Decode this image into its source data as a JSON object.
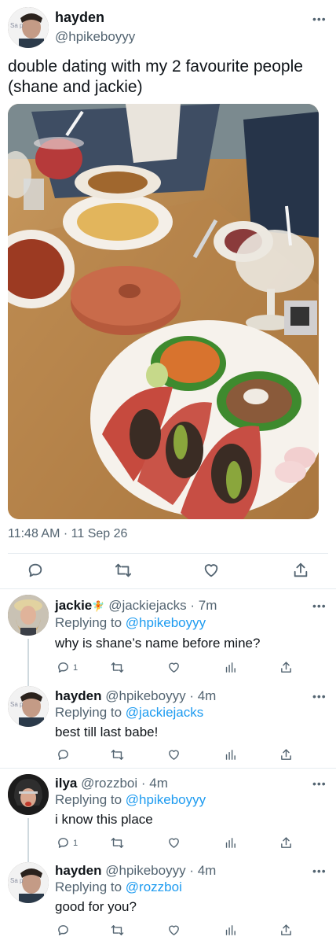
{
  "main_tweet": {
    "display_name": "hayden",
    "handle": "@hpikeboyyy",
    "text": "double dating with my 2 favourite people (shane and jackie)",
    "timestamp": "11:48 AM · 11 Sep 26",
    "avatar_text": "Sa p",
    "more": "•••"
  },
  "main_actions": [
    "reply-icon",
    "retweet-icon",
    "like-icon",
    "share-icon"
  ],
  "replies": [
    {
      "display_name": "jackie",
      "emoji": "🧚",
      "handle": "@jackiejacks",
      "time": "· 7m",
      "replying_prefix": "Replying to",
      "replying_to": "@hpikeboyyy",
      "text": "why is shane’s name before mine?",
      "reply_count": "1",
      "more": "•••"
    },
    {
      "display_name": "hayden",
      "handle": "@hpikeboyyy",
      "time": "· 4m",
      "replying_prefix": "Replying to",
      "replying_to": "@jackiejacks",
      "text": "best till last babe!",
      "reply_count": "",
      "avatar_text": "Sa p",
      "more": "•••"
    },
    {
      "display_name": "ilya",
      "handle": "@rozzboi",
      "time": "· 4m",
      "replying_prefix": "Replying to",
      "replying_to": "@hpikeboyyy",
      "text": "i know this place",
      "reply_count": "1",
      "more": "•••"
    },
    {
      "display_name": "hayden",
      "handle": "@hpikeboyyy",
      "time": "· 4m",
      "replying_prefix": "Replying to",
      "replying_to": "@rozzboi",
      "text": "good for you?",
      "reply_count": "",
      "avatar_text": "Sa p",
      "more": "•••"
    }
  ],
  "colors": {
    "link": "#1d9bf0",
    "muted": "#536471",
    "divider": "#e6ecf0"
  }
}
